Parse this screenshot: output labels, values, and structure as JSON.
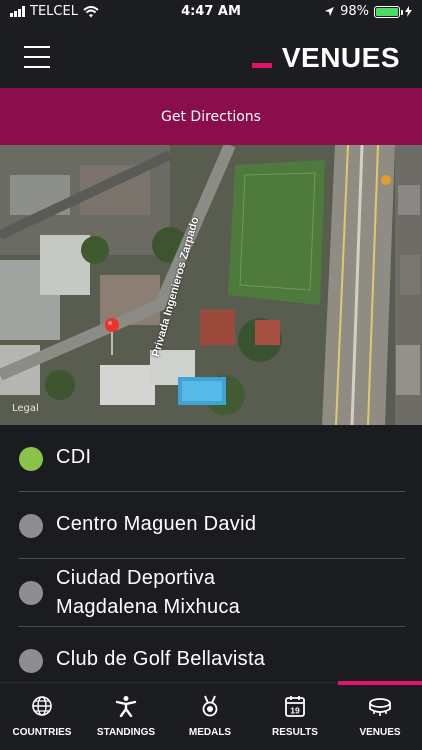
{
  "status_bar": {
    "carrier": "TELCEL",
    "time": "4:47 AM",
    "battery": "98%",
    "battery_level": 0.98
  },
  "header": {
    "title": "VENUES",
    "menu_icon": "hamburger-menu-icon"
  },
  "directions": {
    "label": "Get Directions"
  },
  "map": {
    "street_name": "Privada Ingenieros Zarpado",
    "legal_label": "Legal",
    "pin_icon": "map-pin-icon"
  },
  "venues": [
    {
      "name": "CDI",
      "selected": true
    },
    {
      "name": "Centro Maguen David",
      "selected": false
    },
    {
      "name": "Ciudad Deportiva\nMagdalena Mixhuca",
      "selected": false
    },
    {
      "name": "Club de Golf Bellavista",
      "selected": false
    }
  ],
  "tabs": [
    {
      "label": "COUNTRIES",
      "icon": "globe-icon"
    },
    {
      "label": "STANDINGS",
      "icon": "athlete-icon"
    },
    {
      "label": "MEDALS",
      "icon": "medal-icon"
    },
    {
      "label": "RESULTS",
      "icon": "calendar-icon",
      "icon_text": "19"
    },
    {
      "label": "VENUES",
      "icon": "stadium-icon",
      "active": true
    }
  ],
  "colors": {
    "accent": "#e0146a",
    "directions_bg": "#8a0e4c",
    "selected_dot": "#8bc34a",
    "unselected_dot": "#8e8e90",
    "background": "#1b1c20"
  }
}
